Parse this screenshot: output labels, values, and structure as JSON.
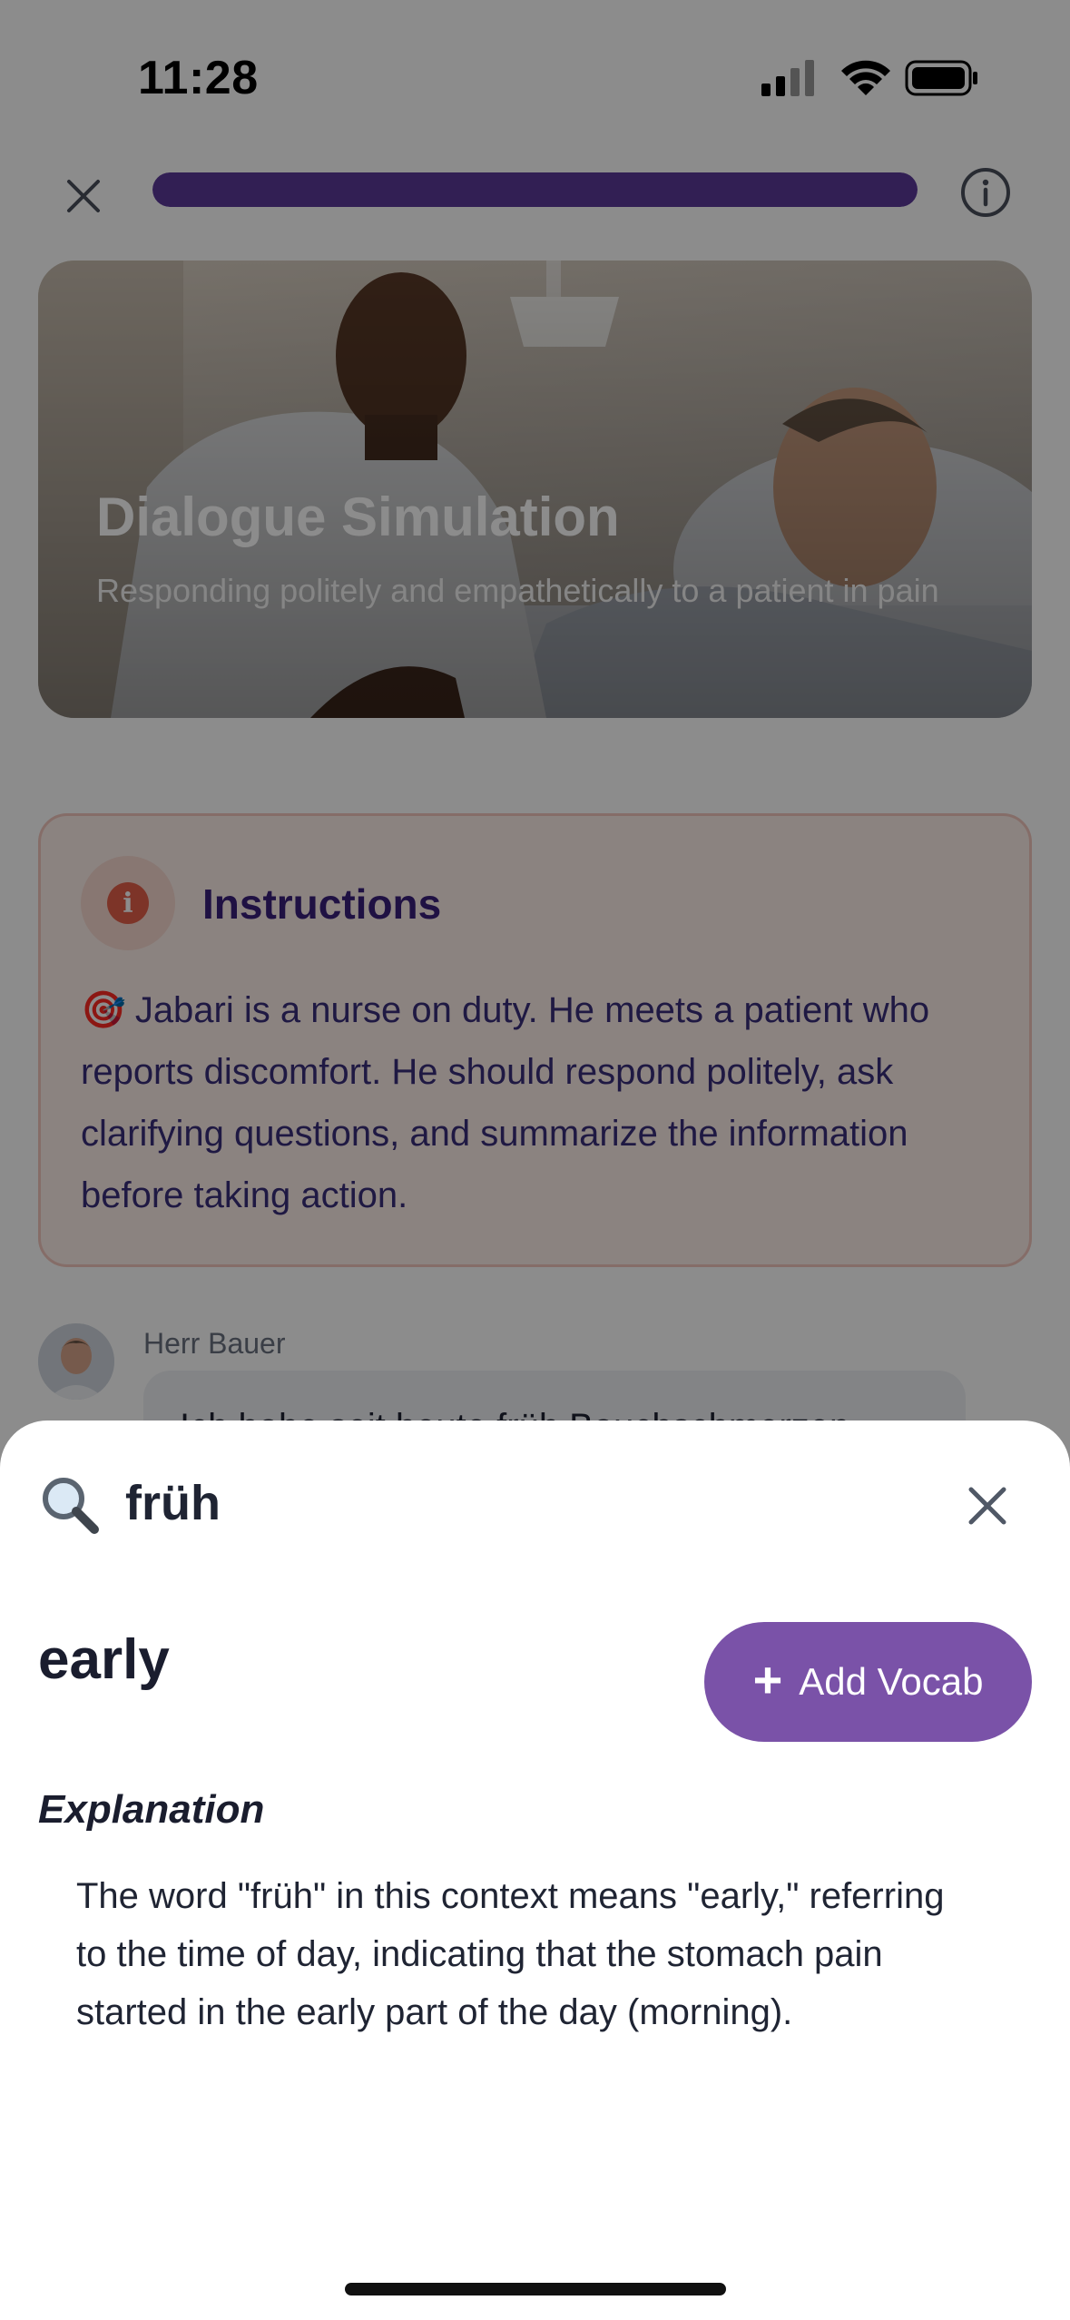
{
  "status_bar": {
    "time": "11:28"
  },
  "lesson": {
    "progress_fraction": 1.0,
    "title": "Dialogue Simulation",
    "subtitle": "Responding politely and empathetically to a patient in pain"
  },
  "instructions": {
    "title": "Instructions",
    "emoji": "🎯",
    "body": "Jabari is a nurse on duty. He meets a patient who reports discomfort. He should respond politely, ask clarifying questions, and summarize the information before taking action."
  },
  "chat": {
    "speaker": "Herr Bauer",
    "message_preview": "Ich habe seit heute früh Bauchschmerzen."
  },
  "lookup": {
    "word": "früh",
    "translation": "early",
    "add_button_label": "Add Vocab",
    "explanation_heading": "Explanation",
    "explanation": "The word \"früh\" in this context means \"early,\" referring to the time of day, indicating that the stomach pain started in the early part of the day (morning)."
  },
  "colors": {
    "accent": "#7a52a8",
    "progress": "#5b3a9a",
    "instructions_bg": "#fdeeea",
    "instructions_title": "#3a1f7a"
  }
}
